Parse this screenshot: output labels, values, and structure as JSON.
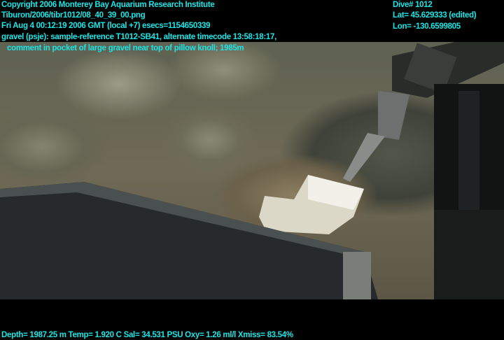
{
  "header": {
    "copyright": "Copyright 2006 Monterey Bay Aquarium Research Institute",
    "file": "Tiburon/2006/tibr1012/08_40_39_00.png",
    "datetime": "Fri Aug  4 00:12:19 2006 GMT (local +7)  esecs=1154650339",
    "annotation": "gravel (psje): sample-reference T1012-SB41, alternate timecode 13:58:18:17,",
    "comment": "comment in pocket of large gravel near top of pillow knoll; 1985m"
  },
  "nav": {
    "dive": "Dive# 1012",
    "lat": "Lat= 45.629333 (edited)",
    "lon": "Lon= -130.6599805"
  },
  "sensors": {
    "line": "Depth= 1987.25 m  Temp= 1.920 C  Sal= 34.531 PSU  Oxy= 1.26 ml/l  Xmiss= 83.54%"
  },
  "colors": {
    "overlay_text": "#19e6e6"
  }
}
